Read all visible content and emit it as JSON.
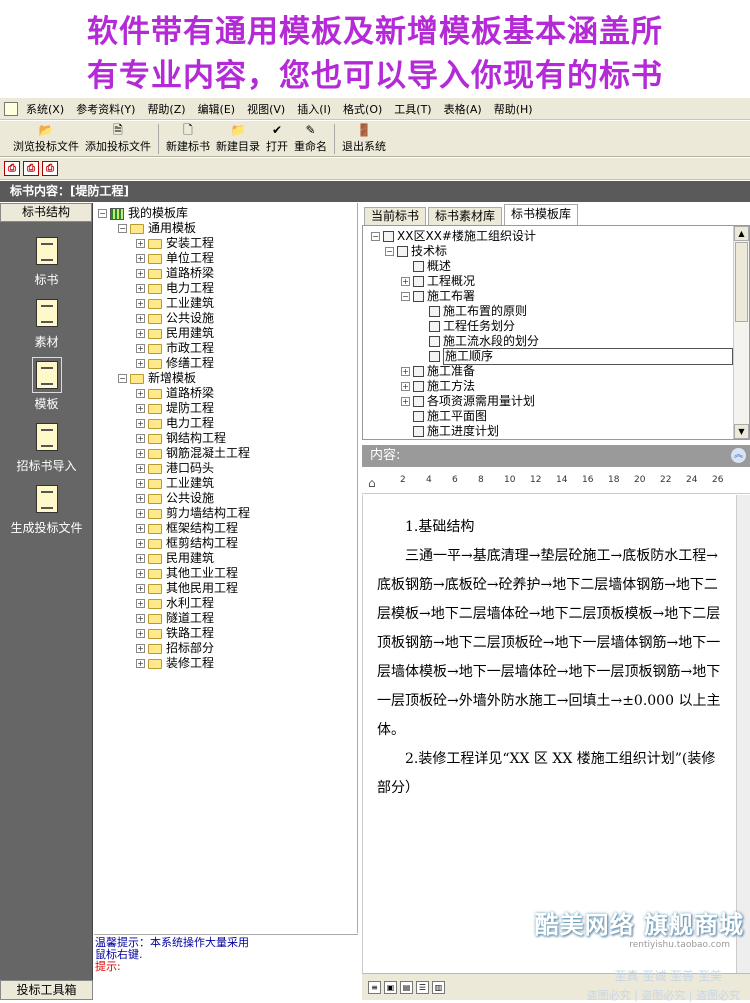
{
  "banner": {
    "line1": "软件带有通用模板及新增模板基本涵盖所",
    "line2": "有专业内容，您也可以导入你现有的标书"
  },
  "menu": [
    "系统(X)",
    "参考资料(Y)",
    "帮助(Z)",
    "编辑(E)",
    "视图(V)",
    "插入(I)",
    "格式(O)",
    "工具(T)",
    "表格(A)",
    "帮助(H)"
  ],
  "toolbar": {
    "browse": "浏览投标文件",
    "add": "添加投标文件",
    "new_book": "新建标书",
    "new_dir": "新建目录",
    "open": "打开",
    "rename": "重命名",
    "exit": "退出系统"
  },
  "title": "标书内容：[堤防工程]",
  "left_panel": {
    "header": "标书结构",
    "items": [
      "标书",
      "素材",
      "模板",
      "招标书导入",
      "生成投标文件"
    ],
    "footer": "投标工具箱"
  },
  "tree": {
    "root": "我的模板库",
    "group1": "通用模板",
    "group1_items": [
      "安装工程",
      "单位工程",
      "道路桥梁",
      "电力工程",
      "工业建筑",
      "公共设施",
      "民用建筑",
      "市政工程",
      "修缮工程"
    ],
    "group2": "新增模板",
    "group2_items": [
      "道路桥梁",
      "堤防工程",
      "电力工程",
      "钢结构工程",
      "钢筋混凝土工程",
      "港口码头",
      "工业建筑",
      "公共设施",
      "剪力墙结构工程",
      "框架结构工程",
      "框剪结构工程",
      "民用建筑",
      "其他工业工程",
      "其他民用工程",
      "水利工程",
      "隧道工程",
      "铁路工程",
      "招标部分",
      "装修工程"
    ]
  },
  "hint": {
    "line1": "温馨提示：本系统操作大量采用",
    "line2": "鼠标右键.",
    "line3": "提示:"
  },
  "tabs": [
    "当前标书",
    "标书素材库",
    "标书模板库"
  ],
  "right_tree": {
    "root": "XX区XX#楼施工组织设计",
    "tech": "技术标",
    "items": [
      "概述",
      "工程概况",
      "施工布署",
      "施工布置的原则",
      "工程任务划分",
      "施工流水段的划分",
      "施工顺序",
      "施工准备",
      "施工方法",
      "各项资源需用量计划",
      "施工平面图",
      "施工进度计划"
    ]
  },
  "content_label": "内容:",
  "ruler_ticks": [
    "2",
    "4",
    "6",
    "8",
    "10",
    "12",
    "14",
    "16",
    "18",
    "20",
    "22",
    "24",
    "26"
  ],
  "doc": {
    "p1": "1.基础结构",
    "p2": "三通一平→基底清理→垫层砼施工→底板防水工程→底板钢筋→底板砼→砼养护→地下二层墙体钢筋→地下二层模板→地下二层墙体砼→地下二层顶板模板→地下二层顶板钢筋→地下二层顶板砼→地下一层墙体钢筋→地下一层墙体模板→地下一层墙体砼→地下一层顶板钢筋→地下一层顶板砼→外墙外防水施工→回填土→±0.000 以上主体。",
    "p3": "2.装修工程详见“XX 区 XX 楼施工组织计划”(装修部分）"
  },
  "watermark": {
    "brand": "酷美网络 旗舰商城",
    "url": "rentiyishu.taobao.com",
    "slogan": "至真 至诚 至善 至美",
    "notice": "盗图必究 | 盗图必究 | 盗图必究"
  },
  "colors": {
    "banner_text": "#b42ad6",
    "panel_gray": "#666666",
    "title_bar": "#5a5a5a"
  }
}
